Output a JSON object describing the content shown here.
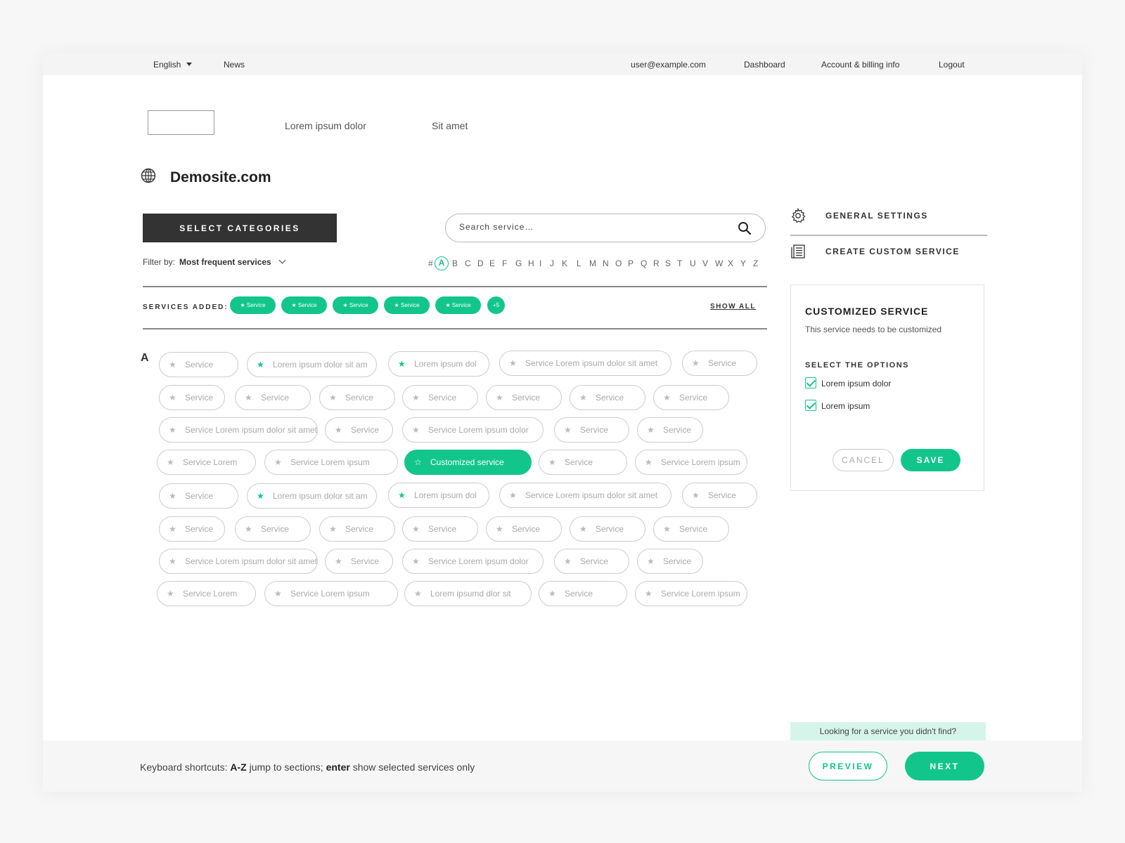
{
  "topbar": {
    "language": "English",
    "news": "News",
    "user_email": "user@example.com",
    "dashboard": "Dashboard",
    "account": "Account & billing info",
    "logout": "Logout"
  },
  "subnav": {
    "item1": "Lorem ipsum dolor",
    "item2": "Sit amet"
  },
  "site": {
    "title": "Demosite.com"
  },
  "toolbar": {
    "select_categories": "SELECT CATEGORIES",
    "search_placeholder": "Search service…",
    "filter_label": "Filter by:",
    "filter_value": "Most frequent services"
  },
  "alphabet": {
    "letters": [
      "#",
      "A",
      "B",
      "C",
      "D",
      "E",
      "F",
      "G",
      "H",
      "I",
      "J",
      "K",
      "L",
      "M",
      "N",
      "O",
      "P",
      "Q",
      "R",
      "S",
      "T",
      "U",
      "V",
      "W",
      "X",
      "Y",
      "Z"
    ],
    "active": "A"
  },
  "services_added": {
    "label": "SERVICES ADDED:",
    "chips": [
      "Service",
      "Service",
      "Service",
      "Service",
      "Service"
    ],
    "more": "+5",
    "show_all": "SHOW ALL"
  },
  "section": {
    "letter": "A"
  },
  "services": [
    {
      "label": "Service",
      "fav": false,
      "selected": false
    },
    {
      "label": "Lorem ipsum dolor sit am",
      "fav": true,
      "selected": false
    },
    {
      "label": "Lorem ipsum dol",
      "fav": true,
      "selected": false
    },
    {
      "label": "Service Lorem ipsum dolor sit amet",
      "fav": false,
      "selected": false
    },
    {
      "label": "Service",
      "fav": false,
      "selected": false
    },
    {
      "label": "Service",
      "fav": false,
      "selected": false
    },
    {
      "label": "Service",
      "fav": false,
      "selected": false
    },
    {
      "label": "Service",
      "fav": false,
      "selected": false
    },
    {
      "label": "Service",
      "fav": false,
      "selected": false
    },
    {
      "label": "Service",
      "fav": false,
      "selected": false
    },
    {
      "label": "Service",
      "fav": false,
      "selected": false
    },
    {
      "label": "Service",
      "fav": false,
      "selected": false
    },
    {
      "label": "Service Lorem ipsum dolor sit amet",
      "fav": false,
      "selected": false
    },
    {
      "label": "Service",
      "fav": false,
      "selected": false
    },
    {
      "label": "Service Lorem ipsum dolor",
      "fav": false,
      "selected": false
    },
    {
      "label": "Service",
      "fav": false,
      "selected": false
    },
    {
      "label": "Service",
      "fav": false,
      "selected": false
    },
    {
      "label": "Service Lorem",
      "fav": false,
      "selected": false
    },
    {
      "label": "Service Lorem ipsum",
      "fav": false,
      "selected": false
    },
    {
      "label": "Customized service",
      "fav": true,
      "selected": true
    },
    {
      "label": "Service",
      "fav": false,
      "selected": false
    },
    {
      "label": "Service Lorem ipsum",
      "fav": false,
      "selected": false
    },
    {
      "label": "Service",
      "fav": false,
      "selected": false
    },
    {
      "label": "Lorem ipsum dolor sit am",
      "fav": true,
      "selected": false
    },
    {
      "label": "Lorem ipsum dol",
      "fav": true,
      "selected": false
    },
    {
      "label": "Service Lorem ipsum dolor sit amet",
      "fav": false,
      "selected": false
    },
    {
      "label": "Service",
      "fav": false,
      "selected": false
    },
    {
      "label": "Service",
      "fav": false,
      "selected": false
    },
    {
      "label": "Service",
      "fav": false,
      "selected": false
    },
    {
      "label": "Service",
      "fav": false,
      "selected": false
    },
    {
      "label": "Service",
      "fav": false,
      "selected": false
    },
    {
      "label": "Service",
      "fav": false,
      "selected": false
    },
    {
      "label": "Service",
      "fav": false,
      "selected": false
    },
    {
      "label": "Service",
      "fav": false,
      "selected": false
    },
    {
      "label": "Service Lorem ipsum dolor sit amet",
      "fav": false,
      "selected": false
    },
    {
      "label": "Service",
      "fav": false,
      "selected": false
    },
    {
      "label": "Service Lorem ipsum dolor",
      "fav": false,
      "selected": false
    },
    {
      "label": "Service",
      "fav": false,
      "selected": false
    },
    {
      "label": "Service",
      "fav": false,
      "selected": false
    },
    {
      "label": "Service Lorem",
      "fav": false,
      "selected": false
    },
    {
      "label": "Service Lorem ipsum",
      "fav": false,
      "selected": false
    },
    {
      "label": "Lorem ipsumd dlor sit",
      "fav": false,
      "selected": false
    },
    {
      "label": "Service",
      "fav": false,
      "selected": false
    },
    {
      "label": "Service Lorem ipsum",
      "fav": false,
      "selected": false
    }
  ],
  "sidebar": {
    "general_settings": "GENERAL SETTINGS",
    "create_custom": "CREATE CUSTOM SERVICE"
  },
  "panel": {
    "title": "CUSTOMIZED SERVICE",
    "description": "This service needs to be customized",
    "options_heading": "SELECT THE OPTIONS",
    "options": [
      {
        "label": "Lorem ipsum dolor",
        "checked": true
      },
      {
        "label": "Lorem ipsum",
        "checked": true
      }
    ],
    "cancel": "CANCEL",
    "save": "SAVE"
  },
  "help": {
    "looking": "Looking for a service you didn't find?"
  },
  "footer": {
    "kb_prefix": "Keyboard shortcuts:",
    "kb_key1": "A-Z",
    "kb_mid": "jump to sections;",
    "kb_key2": "enter",
    "kb_suffix": "show selected services only",
    "preview": "PREVIEW",
    "next": "NEXT"
  },
  "colors": {
    "accent": "#12c68b",
    "dark_button": "#333333",
    "help_bg": "#d6f5ea"
  }
}
